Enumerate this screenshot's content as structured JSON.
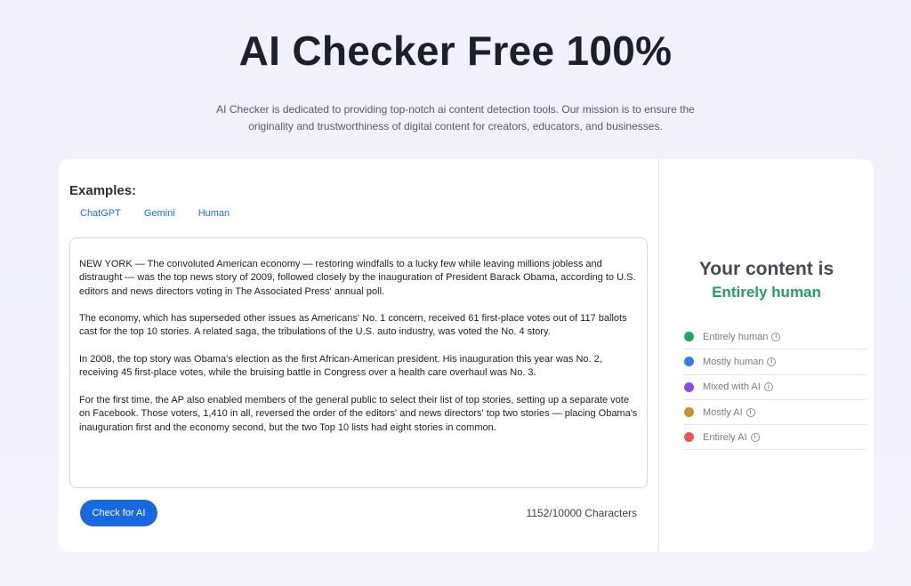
{
  "hero": {
    "title": "AI Checker Free 100%",
    "subtitle": "AI Checker is dedicated to providing top-notch ai content detection tools. Our mission is to ensure the originality and trustworthiness of digital content for creators, educators, and businesses."
  },
  "examples": {
    "title": "Examples:",
    "links": [
      "ChatGPT",
      "Gemini",
      "Human"
    ]
  },
  "editor": {
    "paragraphs": [
      "NEW YORK — The convoluted American economy — restoring windfalls to a lucky few while leaving millions jobless and distraught — was the top news story of 2009, followed closely by the inauguration of President Barack Obama, according to U.S. editors and news directors voting in The Associated Press' annual poll.",
      "The economy, which has superseded other issues as Americans' No. 1 concern, received 61 first-place votes out of 117 ballots cast for the top 10 stories. A related saga, the tribulations of the U.S. auto industry, was voted the No. 4 story.",
      "In 2008, the top story was Obama's election as the first African-American president. His inauguration this year was No. 2, receiving 45 first-place votes, while the bruising battle in Congress over a health care overhaul was No. 3.",
      "For the first time, the AP also enabled members of the general public to select their list of top stories, setting up a separate vote on Facebook. Those voters, 1,410 in all, reversed the order of the editors' and news directors' top two stories — placing Obama's inauguration first and the economy second, but the two Top 10 lists had eight stories in common."
    ]
  },
  "actions": {
    "check_label": "Check for AI",
    "char_count": "1152/10000 Characters"
  },
  "result": {
    "title": "Your content is",
    "value": "Entirely human",
    "value_color": "#1fa163"
  },
  "legend": [
    {
      "label": "Entirely human",
      "color": "#1aa865",
      "icon": "info-icon"
    },
    {
      "label": "Mostly human",
      "color": "#2f7fe6",
      "icon": "info-icon"
    },
    {
      "label": "Mixed with AI",
      "color": "#8b4be6",
      "icon": "info-icon"
    },
    {
      "label": "Mostly AI",
      "color": "#c99422",
      "icon": "info-icon"
    },
    {
      "label": "Entirely AI",
      "color": "#ec5454",
      "icon": "info-icon"
    }
  ]
}
